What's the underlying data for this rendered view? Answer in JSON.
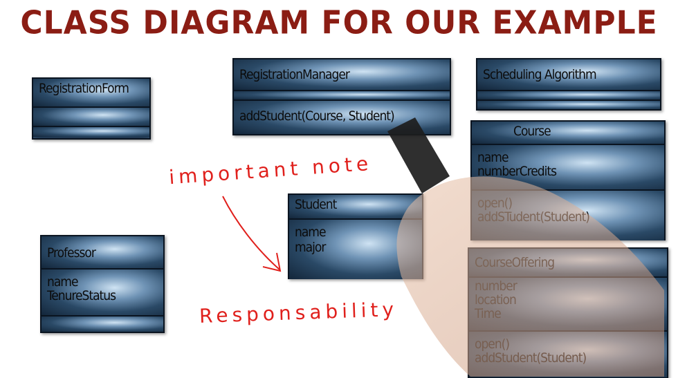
{
  "title": "CLASS DIAGRAM FOR OUR EXAMPLE",
  "classes": {
    "registration_form": {
      "name": "RegistrationForm",
      "attributes": [],
      "operations": []
    },
    "registration_manager": {
      "name": "RegistrationManager",
      "operations": [
        "addStudent(Course, Student)"
      ]
    },
    "scheduling_algorithm": {
      "name": "Scheduling Algorithm",
      "attributes": []
    },
    "course": {
      "name": "Course",
      "attributes": [
        "name",
        "numberCredits"
      ],
      "operations": [
        "open()",
        "addSTudent(Student)"
      ]
    },
    "student": {
      "name": "Student",
      "attributes": [
        "name",
        "major"
      ]
    },
    "professor": {
      "name": "Professor",
      "attributes": [
        "name",
        "TenureStatus"
      ]
    },
    "course_offering": {
      "name": "CourseOffering",
      "attributes": [
        "number",
        "location",
        "Time"
      ],
      "operations": [
        "open()",
        "addStudent(Student)"
      ]
    }
  },
  "annotations": {
    "important_note": "important  note",
    "responsibility": "Responsability"
  },
  "colors": {
    "title": "#8b1d14",
    "annotation": "#e0201c",
    "box": "#13263a"
  }
}
